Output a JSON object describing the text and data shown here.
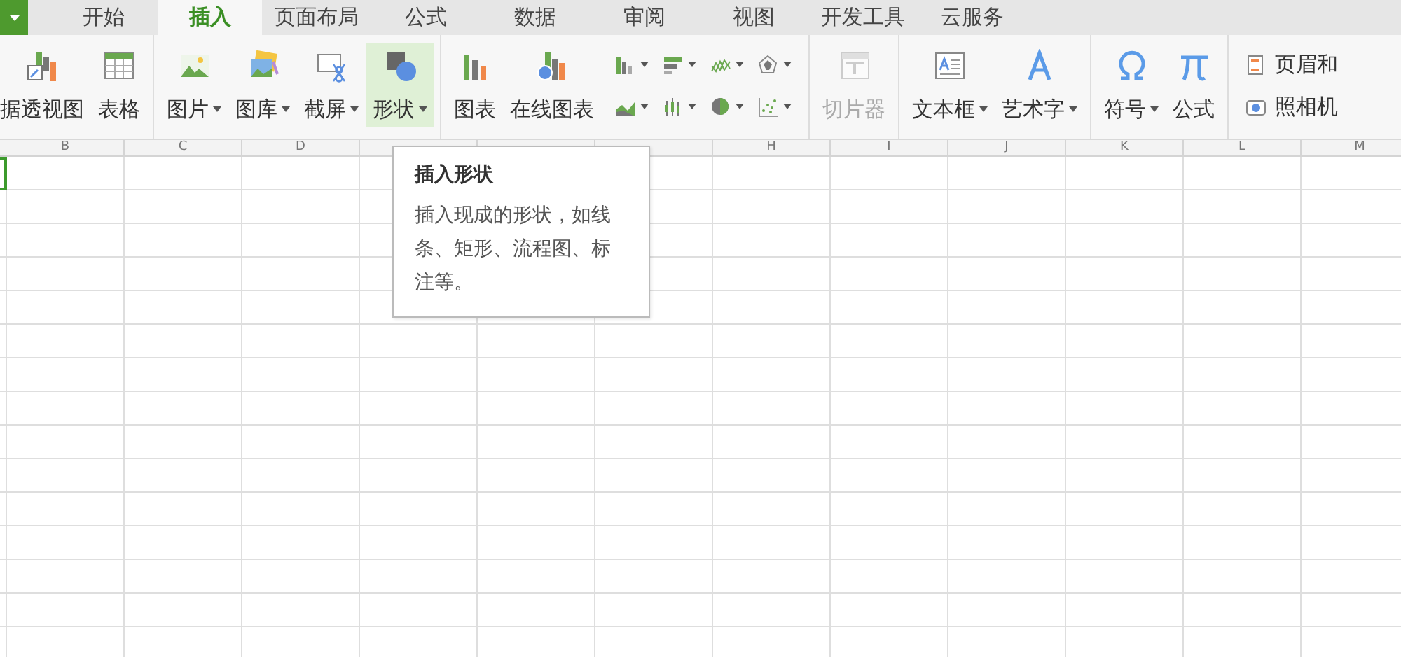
{
  "tabs": [
    {
      "label": "开始",
      "selected": false
    },
    {
      "label": "插入",
      "selected": true
    },
    {
      "label": "页面布局",
      "selected": false
    },
    {
      "label": "公式",
      "selected": false
    },
    {
      "label": "数据",
      "selected": false
    },
    {
      "label": "审阅",
      "selected": false
    },
    {
      "label": "视图",
      "selected": false
    },
    {
      "label": "开发工具",
      "selected": false
    },
    {
      "label": "云服务",
      "selected": false
    }
  ],
  "ribbon": {
    "groups": [
      {
        "buttons": [
          {
            "label": "据透视图",
            "dropdown": false,
            "hovered": false,
            "disabled": false
          },
          {
            "label": "表格",
            "dropdown": false,
            "hovered": false,
            "disabled": false
          }
        ]
      },
      {
        "buttons": [
          {
            "label": "图片",
            "dropdown": true,
            "hovered": false,
            "disabled": false
          },
          {
            "label": "图库",
            "dropdown": true,
            "hovered": false,
            "disabled": false
          },
          {
            "label": "截屏",
            "dropdown": true,
            "hovered": false,
            "disabled": false
          },
          {
            "label": "形状",
            "dropdown": true,
            "hovered": true,
            "disabled": false
          }
        ]
      },
      {
        "buttons": [
          {
            "label": "图表",
            "dropdown": false,
            "hovered": false,
            "disabled": false
          },
          {
            "label": "在线图表",
            "dropdown": false,
            "hovered": false,
            "disabled": false
          }
        ],
        "mini_charts": [
          {
            "dropdown": true
          },
          {
            "dropdown": true
          },
          {
            "dropdown": true
          },
          {
            "dropdown": true
          },
          {
            "dropdown": true
          },
          {
            "dropdown": true
          },
          {
            "dropdown": true
          },
          {
            "dropdown": true
          }
        ]
      },
      {
        "buttons": [
          {
            "label": "切片器",
            "dropdown": false,
            "hovered": false,
            "disabled": true
          }
        ]
      },
      {
        "buttons": [
          {
            "label": "文本框",
            "dropdown": true,
            "hovered": false,
            "disabled": false
          },
          {
            "label": "艺术字",
            "dropdown": true,
            "hovered": false,
            "disabled": false
          }
        ]
      },
      {
        "buttons": [
          {
            "label": "符号",
            "dropdown": true,
            "hovered": false,
            "disabled": false
          },
          {
            "label": "公式",
            "dropdown": false,
            "hovered": false,
            "disabled": false
          }
        ]
      },
      {
        "small_buttons": [
          {
            "label": "页眉和"
          },
          {
            "label": "照相机"
          }
        ]
      }
    ]
  },
  "sheet": {
    "columns_left": [
      "B",
      "C",
      "D"
    ],
    "columns_right": [
      "H",
      "I",
      "J",
      "K",
      "L",
      "M"
    ]
  },
  "tooltip": {
    "title": "插入形状",
    "text": "插入现成的形状，如线条、矩形、流程图、标注等。"
  }
}
